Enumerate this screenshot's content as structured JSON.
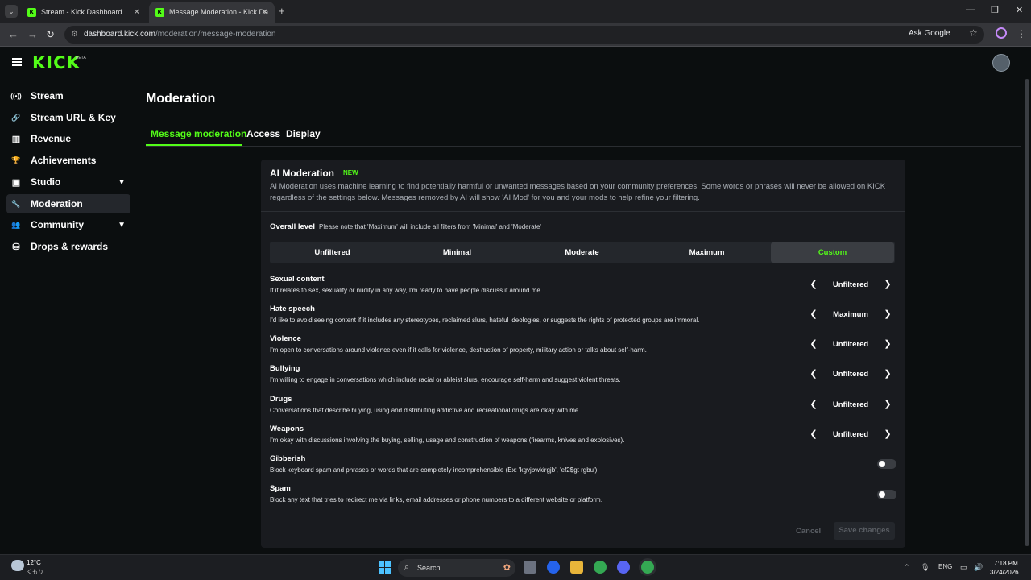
{
  "browser": {
    "tabs": [
      {
        "title": "Stream - Kick Dashboard",
        "favicon": "K",
        "active": false
      },
      {
        "title": "Message Moderation - Kick Da",
        "favicon": "K",
        "active": true
      }
    ],
    "new_tab": "+",
    "url_domain": "dashboard.kick.com",
    "url_path": "/moderation/message-moderation",
    "ask_google": "Ask Google"
  },
  "header": {
    "logo": "KICK",
    "logo_badge": "BETA"
  },
  "sidebar": {
    "items": [
      {
        "label": "Stream",
        "icon": "broadcast-icon",
        "glyph": "((•))",
        "active": false,
        "expandable": false
      },
      {
        "label": "Stream URL & Key",
        "icon": "link-icon",
        "glyph": "🔗",
        "active": false,
        "expandable": false
      },
      {
        "label": "Revenue",
        "icon": "chart-icon",
        "glyph": "▥",
        "active": false,
        "expandable": false
      },
      {
        "label": "Achievements",
        "icon": "trophy-icon",
        "glyph": "🏆",
        "active": false,
        "expandable": false
      },
      {
        "label": "Studio",
        "icon": "studio-icon",
        "glyph": "▣",
        "active": false,
        "expandable": true
      },
      {
        "label": "Moderation",
        "icon": "wrench-icon",
        "glyph": "🔧",
        "active": true,
        "expandable": false
      },
      {
        "label": "Community",
        "icon": "community-icon",
        "glyph": "👥",
        "active": false,
        "expandable": true
      },
      {
        "label": "Drops & rewards",
        "icon": "drops-icon",
        "glyph": "⛁",
        "active": false,
        "expandable": false
      }
    ]
  },
  "main": {
    "title": "Moderation",
    "tabs": [
      {
        "label": "Message moderation",
        "active": true
      },
      {
        "label": "Access",
        "active": false
      },
      {
        "label": "Display",
        "active": false
      }
    ]
  },
  "ai": {
    "title": "AI Moderation",
    "badge": "NEW",
    "description": "AI Moderation uses machine learning to find potentially harmful or unwanted messages based on your community preferences. Some words or phrases will never be allowed on KICK regardless of the settings below. Messages removed by AI will show 'AI Mod' for you and your mods to help refine your filtering.",
    "overall_label": "Overall level",
    "overall_note": "Please note that 'Maximum' will include all filters from 'Minimal' and 'Moderate'",
    "levels": [
      "Unfiltered",
      "Minimal",
      "Moderate",
      "Maximum",
      "Custom"
    ],
    "selected_level": "Custom",
    "categories": [
      {
        "title": "Sexual content",
        "desc": "If it relates to sex, sexuality or nudity in any way, I'm ready to have people discuss it around me.",
        "value": "Unfiltered"
      },
      {
        "title": "Hate speech",
        "desc": "I'd like to avoid seeing content if it includes any stereotypes, reclaimed slurs, hateful ideologies, or suggests the rights of protected groups are immoral.",
        "value": "Maximum"
      },
      {
        "title": "Violence",
        "desc": "I'm open to conversations around violence even if it calls for violence, destruction of property, military action or talks about self-harm.",
        "value": "Unfiltered"
      },
      {
        "title": "Bullying",
        "desc": "I'm willing to engage in conversations which include racial or ableist slurs, encourage self-harm and suggest violent threats.",
        "value": "Unfiltered"
      },
      {
        "title": "Drugs",
        "desc": "Conversations that describe buying, using and distributing addictive and recreational drugs are okay with me.",
        "value": "Unfiltered"
      },
      {
        "title": "Weapons",
        "desc": "I'm okay with discussions involving the buying, selling, usage and construction of weapons (firearms, knives and explosives).",
        "value": "Unfiltered"
      }
    ],
    "toggles": [
      {
        "title": "Gibberish",
        "desc": "Block keyboard spam and phrases or words that are completely incomprehensible (Ex: 'kgvjbwkirgjb', 'ef2$gt rgbu').",
        "on": false
      },
      {
        "title": "Spam",
        "desc": "Block any text that tries to redirect me via links, email addresses or phone numbers to a different website or platform.",
        "on": false
      }
    ],
    "cancel": "Cancel",
    "save": "Save changes"
  },
  "taskbar": {
    "temp": "12°C",
    "condition": "くもり",
    "search": "Search",
    "lang": "ENG",
    "time": "7:18 PM",
    "date": "3/24/2026"
  },
  "colors": {
    "accent": "#53fc18",
    "background": "#0b0e0f",
    "panel": "#191b1f"
  }
}
